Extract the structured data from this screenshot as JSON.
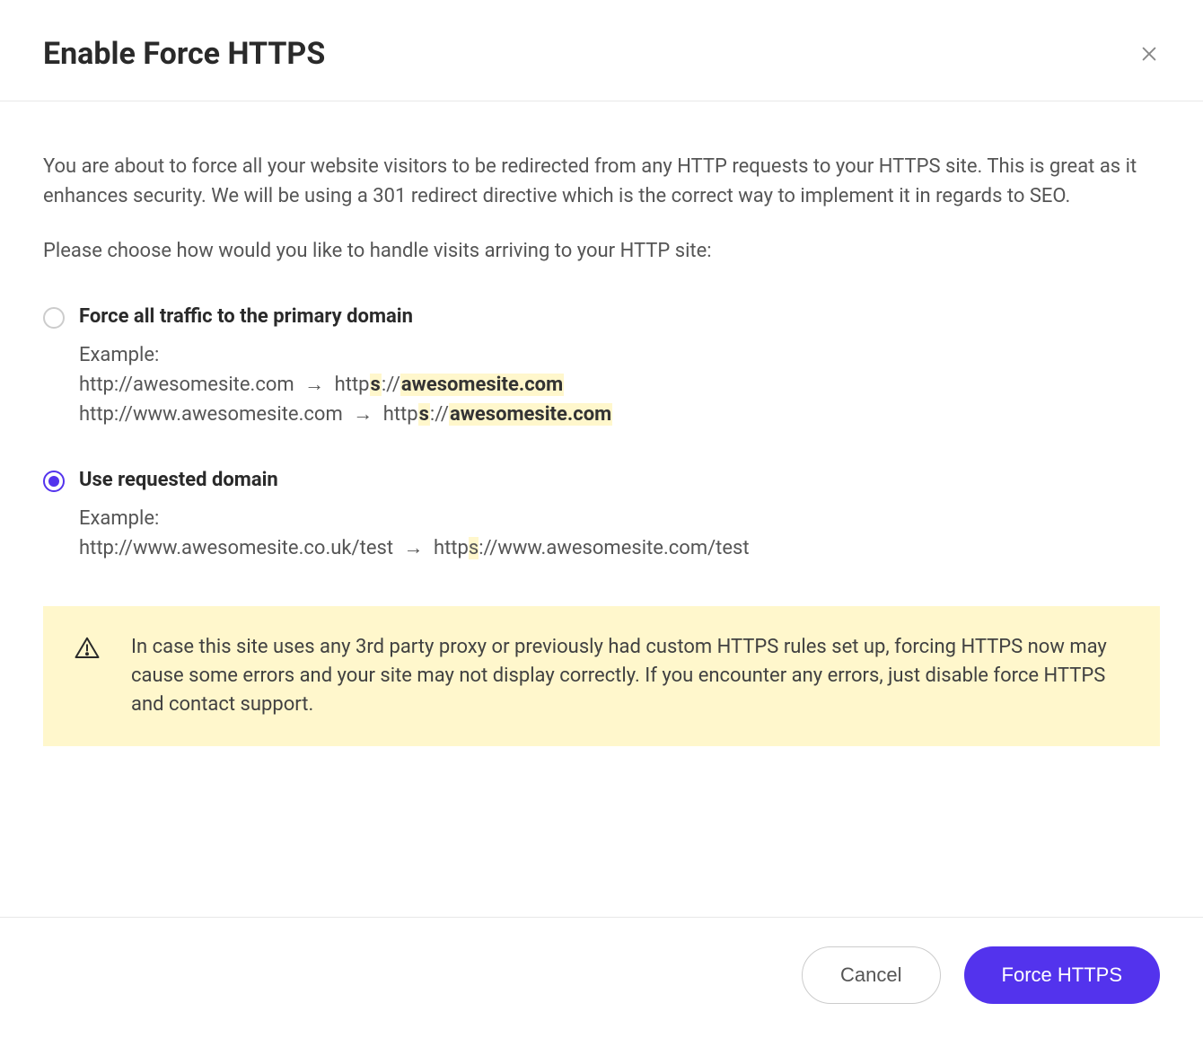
{
  "header": {
    "title": "Enable Force HTTPS"
  },
  "body": {
    "description": "You are about to force all your website visitors to be redirected from any HTTP requests to your HTTPS site. This is great as it enhances security. We will be using a 301 redirect directive which is the correct way to implement it in regards to SEO.",
    "prompt": "Please choose how would you like to handle visits arriving to your HTTP site:"
  },
  "options": {
    "primary": {
      "label": "Force all traffic to the primary domain",
      "example_label": "Example:",
      "ex1_from": "http://awesomesite.com",
      "ex1_to_prefix": "http",
      "ex1_to_hl1": "s",
      "ex1_to_mid": "://",
      "ex1_to_hl2": "awesomesite.com",
      "ex2_from": "http://www.awesomesite.com",
      "ex2_to_prefix": "http",
      "ex2_to_hl1": "s",
      "ex2_to_mid": "://",
      "ex2_to_hl2": "awesomesite.com",
      "selected": false
    },
    "requested": {
      "label": "Use requested domain",
      "example_label": "Example:",
      "ex1_from": "http://www.awesomesite.co.uk/test",
      "ex1_to_prefix": "http",
      "ex1_to_hl1": "s",
      "ex1_to_suffix": "://www.awesomesite.com/test",
      "selected": true
    }
  },
  "arrow": "→",
  "warning": {
    "text": "In case this site uses any 3rd party proxy or previously had custom HTTPS rules set up, forcing HTTPS now may cause some errors and your site may not display correctly. If you encounter any errors, just disable force HTTPS and contact support."
  },
  "footer": {
    "cancel": "Cancel",
    "confirm": "Force HTTPS"
  }
}
